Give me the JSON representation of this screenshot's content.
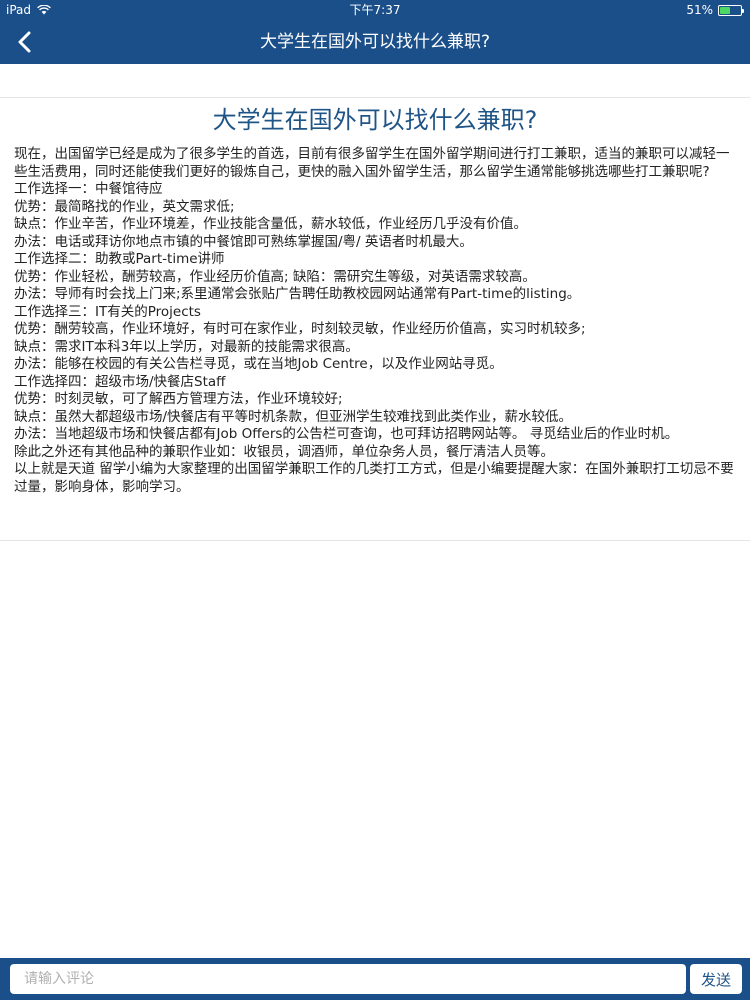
{
  "status_bar": {
    "device": "iPad",
    "time": "下午7:37",
    "battery": "51%",
    "battery_level": 0.51
  },
  "nav": {
    "title": "大学生在国外可以找什么兼职?"
  },
  "article": {
    "title": "大学生在国外可以找什么兼职?",
    "paragraphs": [
      "现在，出国留学已经是成为了很多学生的首选，目前有很多留学生在国外留学期间进行打工兼职，适当的兼职可以减轻一些生活费用，同时还能使我们更好的锻炼自己，更快的融入国外留学生活，那么留学生通常能够挑选哪些打工兼职呢?",
      "工作选择一：中餐馆待应",
      "优势：最简略找的作业，英文需求低;",
      "缺点：作业辛苦，作业环境差，作业技能含量低，薪水较低，作业经历几乎没有价值。",
      "办法：电话或拜访你地点市镇的中餐馆即可熟练掌握国/粤/ 英语者时机最大。",
      "工作选择二：助教或Part-time讲师",
      "优势：作业轻松，酬劳较高，作业经历价值高; 缺陷：需研究生等级，对英语需求较高。",
      "办法：导师有时会找上门来;系里通常会张贴广告聘任助教校园网站通常有Part-time的listing。",
      "工作选择三：IT有关的Projects",
      "优势：酬劳较高，作业环境好，有时可在家作业，时刻较灵敏，作业经历价值高，实习时机较多;",
      "缺点：需求IT本科3年以上学历，对最新的技能需求很高。",
      "办法：能够在校园的有关公告栏寻觅，或在当地Job Centre，以及作业网站寻觅。",
      "工作选择四：超级市场/快餐店Staff",
      "优势：时刻灵敏，可了解西方管理方法，作业环境较好;",
      "缺点：虽然大都超级市场/快餐店有平等时机条款，但亚洲学生较难找到此类作业，薪水较低。",
      "办法：当地超级市场和快餐店都有Job Offers的公告栏可查询，也可拜访招聘网站等。 寻觅结业后的作业时机。",
      "除此之外还有其他品种的兼职作业如：收银员，调酒师，单位杂务人员，餐厅清洁人员等。",
      "以上就是天道 留学小编为大家整理的出国留学兼职工作的几类打工方式，但是小编要提醒大家：在国外兼职打工切忌不要过量，影响身体，影响学习。"
    ]
  },
  "comment_bar": {
    "placeholder": "请输入评论",
    "value": "",
    "send_label": "发送"
  },
  "icons": {
    "back": "chevron-left-icon",
    "wifi": "wifi-icon",
    "battery": "battery-icon"
  },
  "colors": {
    "nav_background": "#1b4f8a",
    "title_color": "#1f5487",
    "battery_fill": "#4cd964"
  }
}
